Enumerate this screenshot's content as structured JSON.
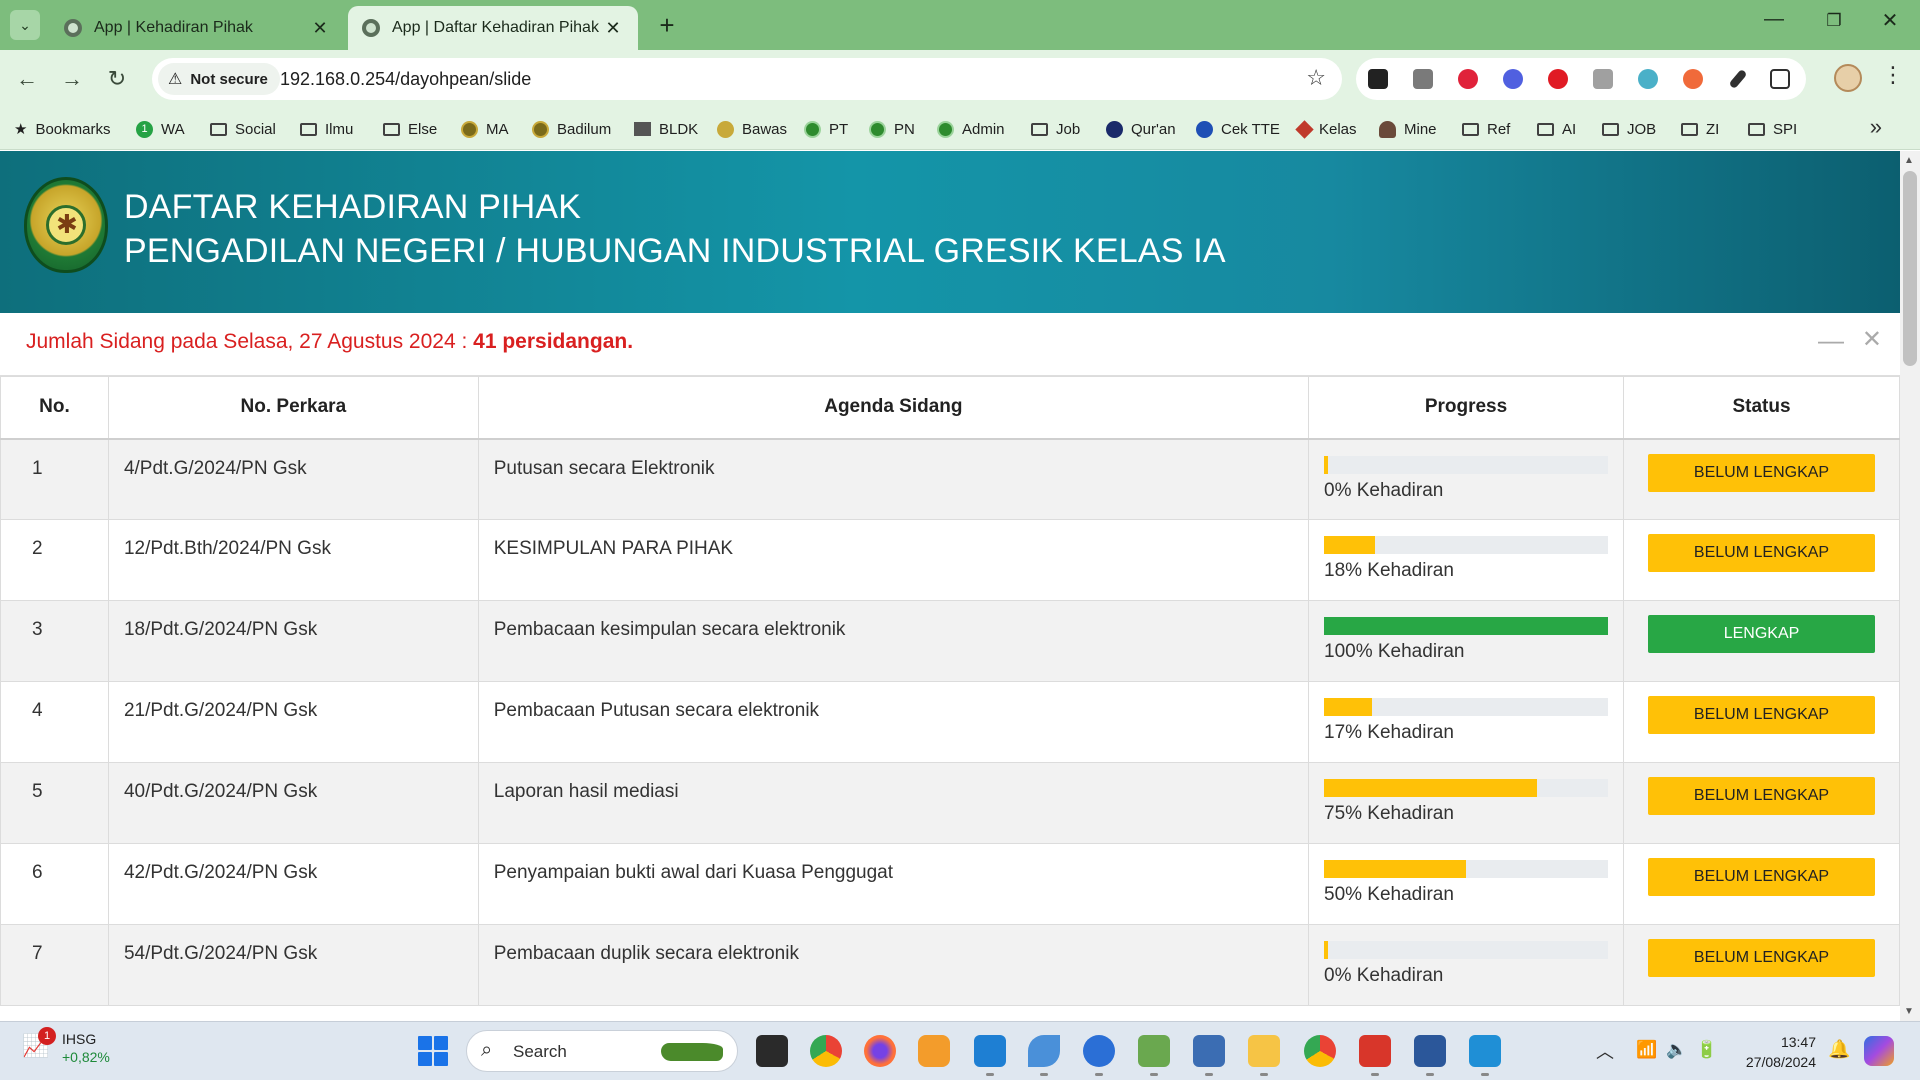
{
  "browser": {
    "tabs": [
      {
        "title": "App | Kehadiran Pihak",
        "active": false
      },
      {
        "title": "App | Daftar Kehadiran Pihak",
        "active": true
      }
    ],
    "security_label": "Not secure",
    "url": "192.168.0.254/dayohpean/slide",
    "bookmarks": [
      "Bookmarks",
      "WA",
      "Social",
      "Ilmu",
      "Else",
      "MA",
      "Badilum",
      "BLDK",
      "Bawas",
      "PT",
      "PN",
      "Admin",
      "Job",
      "Qur'an",
      "Cek TTE",
      "Kelas",
      "Mine",
      "Ref",
      "AI",
      "JOB",
      "ZI",
      "SPI"
    ],
    "wa_badge": "1"
  },
  "header": {
    "line1": "DAFTAR KEHADIRAN PIHAK",
    "line2": "PENGADILAN NEGERI / HUBUNGAN INDUSTRIAL GRESIK KELAS IA"
  },
  "summary": {
    "prefix": "Jumlah Sidang pada Selasa, 27 Agustus 2024 : ",
    "count": "41 persidangan."
  },
  "table": {
    "headers": [
      "No.",
      "No. Perkara",
      "Agenda Sidang",
      "Progress",
      "Status"
    ],
    "rows": [
      {
        "no": "1",
        "perkara": "4/Pdt.G/2024/PN Gsk",
        "agenda": "Putusan secara Elektronik",
        "progress": 0,
        "progress_label": "0% Kehadiran",
        "status": "BELUM LENGKAP"
      },
      {
        "no": "2",
        "perkara": "12/Pdt.Bth/2024/PN Gsk",
        "agenda": "KESIMPULAN PARA PIHAK",
        "progress": 18,
        "progress_label": "18% Kehadiran",
        "status": "BELUM LENGKAP"
      },
      {
        "no": "3",
        "perkara": "18/Pdt.G/2024/PN Gsk",
        "agenda": "Pembacaan kesimpulan secara elektronik",
        "progress": 100,
        "progress_label": "100% Kehadiran",
        "status": "LENGKAP"
      },
      {
        "no": "4",
        "perkara": "21/Pdt.G/2024/PN Gsk",
        "agenda": "Pembacaan Putusan secara elektronik",
        "progress": 17,
        "progress_label": "17% Kehadiran",
        "status": "BELUM LENGKAP"
      },
      {
        "no": "5",
        "perkara": "40/Pdt.G/2024/PN Gsk",
        "agenda": "Laporan hasil mediasi",
        "progress": 75,
        "progress_label": "75% Kehadiran",
        "status": "BELUM LENGKAP"
      },
      {
        "no": "6",
        "perkara": "42/Pdt.G/2024/PN Gsk",
        "agenda": "Penyampaian bukti awal dari Kuasa Penggugat",
        "progress": 50,
        "progress_label": "50% Kehadiran",
        "status": "BELUM LENGKAP"
      },
      {
        "no": "7",
        "perkara": "54/Pdt.G/2024/PN Gsk",
        "agenda": "Pembacaan duplik secara elektronik",
        "progress": 0,
        "progress_label": "0% Kehadiran",
        "status": "BELUM LENGKAP"
      }
    ]
  },
  "colors": {
    "incomplete": "#ffc107",
    "complete": "#28a745",
    "summary_red": "#d92020",
    "header_teal": "#1495a8"
  },
  "taskbar": {
    "widget_badge": "1",
    "widget_name": "IHSG",
    "widget_change": "+0,82%",
    "search_label": "Search",
    "time": "13:47",
    "date": "27/08/2024"
  }
}
